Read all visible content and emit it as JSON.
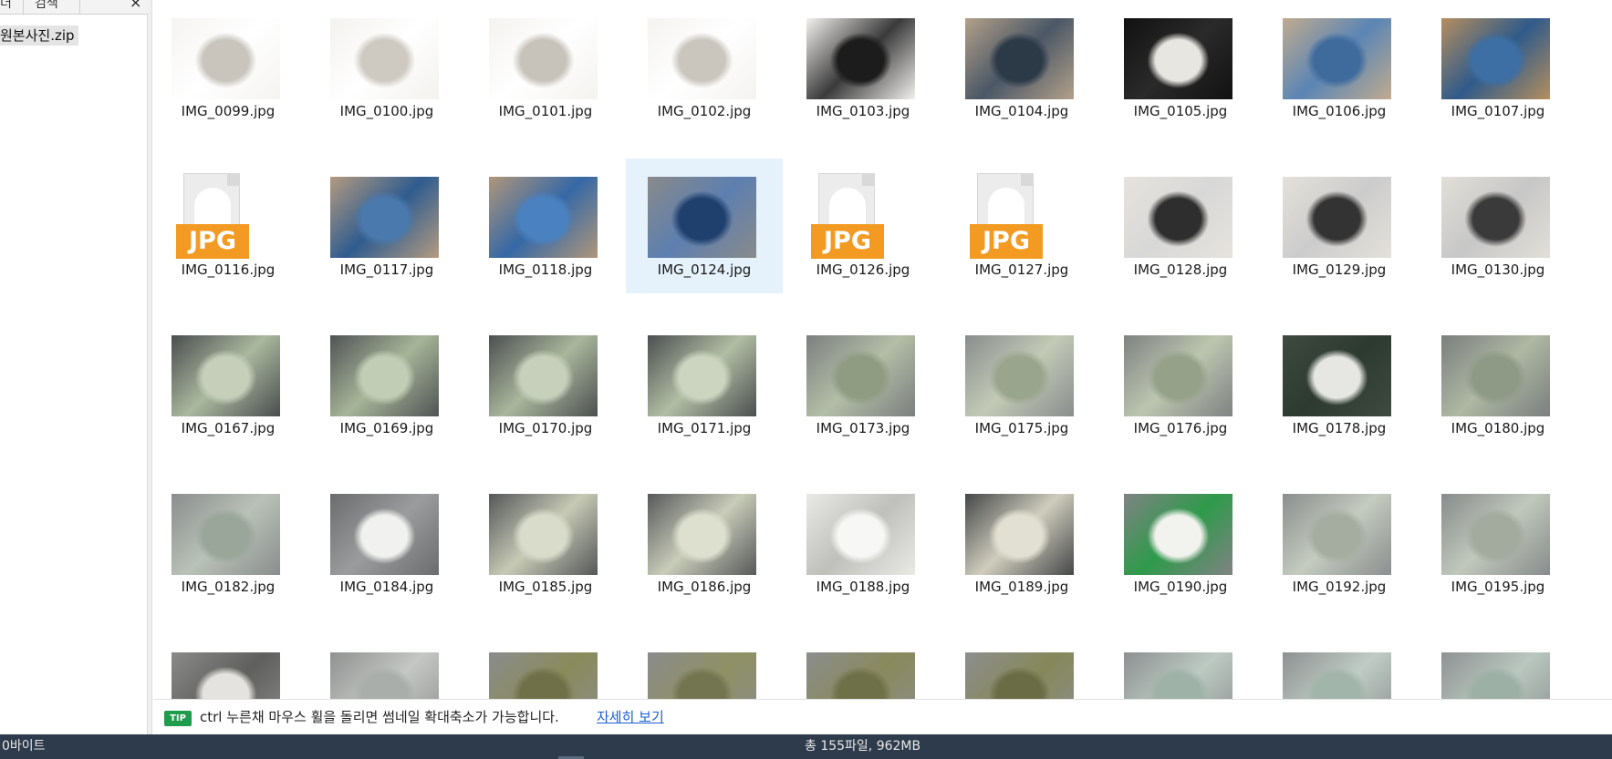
{
  "left_panel": {
    "tabs": [
      "더",
      "검색"
    ],
    "close_label": "×",
    "tree_item": "원본사진.zip"
  },
  "files": [
    {
      "name": "IMG_0099.jpg",
      "kind": "photo",
      "palette": [
        "#f5f4f1",
        "#c9c5bd",
        "#ffffff"
      ]
    },
    {
      "name": "IMG_0100.jpg",
      "kind": "photo",
      "palette": [
        "#f3f2ee",
        "#cfcac1",
        "#ffffff"
      ]
    },
    {
      "name": "IMG_0101.jpg",
      "kind": "photo",
      "palette": [
        "#f4f3ef",
        "#c8c3ba",
        "#ffffff"
      ]
    },
    {
      "name": "IMG_0102.jpg",
      "kind": "photo",
      "palette": [
        "#f4f3f0",
        "#cac5bd",
        "#ffffff"
      ]
    },
    {
      "name": "IMG_0103.jpg",
      "kind": "photo",
      "palette": [
        "#f2f1ee",
        "#1c1c1c",
        "#3a3a3a"
      ]
    },
    {
      "name": "IMG_0104.jpg",
      "kind": "photo",
      "palette": [
        "#b3a089",
        "#2c3a48",
        "#4a5766"
      ]
    },
    {
      "name": "IMG_0105.jpg",
      "kind": "photo",
      "palette": [
        "#111111",
        "#e8e6e0",
        "#2a2a2a"
      ]
    },
    {
      "name": "IMG_0106.jpg",
      "kind": "photo",
      "palette": [
        "#c1ab8e",
        "#3e6a9c",
        "#5a85b5"
      ]
    },
    {
      "name": "IMG_0107.jpg",
      "kind": "photo",
      "palette": [
        "#b58e5e",
        "#3d6fa5",
        "#2f5a8a"
      ]
    },
    {
      "name": "IMG_0116.jpg",
      "kind": "jpg"
    },
    {
      "name": "IMG_0117.jpg",
      "kind": "photo",
      "palette": [
        "#b49a80",
        "#4a79ad",
        "#2f5c8f"
      ]
    },
    {
      "name": "IMG_0118.jpg",
      "kind": "photo",
      "palette": [
        "#b0967a",
        "#4a82c1",
        "#3568a6"
      ]
    },
    {
      "name": "IMG_0124.jpg",
      "kind": "photo",
      "palette": [
        "#8a8a8a",
        "#1f3f6d",
        "#5c7fb0"
      ],
      "selected": true
    },
    {
      "name": "IMG_0126.jpg",
      "kind": "jpg"
    },
    {
      "name": "IMG_0127.jpg",
      "kind": "jpg"
    },
    {
      "name": "IMG_0128.jpg",
      "kind": "photo",
      "palette": [
        "#e6e3dd",
        "#2e2e2e",
        "#d8d8d8"
      ]
    },
    {
      "name": "IMG_0129.jpg",
      "kind": "photo",
      "palette": [
        "#e4e1da",
        "#333333",
        "#cccccc"
      ]
    },
    {
      "name": "IMG_0130.jpg",
      "kind": "photo",
      "palette": [
        "#e2dfd8",
        "#3a3a3a",
        "#c7c7c7"
      ]
    },
    {
      "name": "IMG_0167.jpg",
      "kind": "photo",
      "palette": [
        "#4a4d4f",
        "#c5cfba",
        "#aab89e"
      ]
    },
    {
      "name": "IMG_0169.jpg",
      "kind": "photo",
      "palette": [
        "#505355",
        "#c2cdb6",
        "#a6b598"
      ]
    },
    {
      "name": "IMG_0170.jpg",
      "kind": "photo",
      "palette": [
        "#4c4f51",
        "#c6d0bb",
        "#a9b79c"
      ]
    },
    {
      "name": "IMG_0171.jpg",
      "kind": "photo",
      "palette": [
        "#4b4e50",
        "#ccd5c0",
        "#b1bea4"
      ]
    },
    {
      "name": "IMG_0173.jpg",
      "kind": "photo",
      "palette": [
        "#7c7f80",
        "#8f9c82",
        "#b3bea7"
      ]
    },
    {
      "name": "IMG_0175.jpg",
      "kind": "photo",
      "palette": [
        "#8a8d8e",
        "#9aa58d",
        "#c2cab6"
      ]
    },
    {
      "name": "IMG_0176.jpg",
      "kind": "photo",
      "palette": [
        "#7f8283",
        "#95a189",
        "#bcc6af"
      ]
    },
    {
      "name": "IMG_0178.jpg",
      "kind": "photo",
      "palette": [
        "#3e4a40",
        "#e6e6e2",
        "#2d3a30"
      ]
    },
    {
      "name": "IMG_0180.jpg",
      "kind": "photo",
      "palette": [
        "#7b7e7f",
        "#8e9a86",
        "#aeb8a3"
      ]
    },
    {
      "name": "IMG_0182.jpg",
      "kind": "photo",
      "palette": [
        "#8a8d8e",
        "#9aa69a",
        "#b9c2b7"
      ]
    },
    {
      "name": "IMG_0184.jpg",
      "kind": "photo",
      "palette": [
        "#6a6c6d",
        "#f1f1ef",
        "#9a9c9d"
      ]
    },
    {
      "name": "IMG_0185.jpg",
      "kind": "photo",
      "palette": [
        "#555759",
        "#d9dccb",
        "#c6cab5"
      ]
    },
    {
      "name": "IMG_0186.jpg",
      "kind": "photo",
      "palette": [
        "#57595b",
        "#dde0cf",
        "#c8ccb8"
      ]
    },
    {
      "name": "IMG_0188.jpg",
      "kind": "photo",
      "palette": [
        "#e9e9e6",
        "#f7f7f5",
        "#bfbfbb"
      ]
    },
    {
      "name": "IMG_0189.jpg",
      "kind": "photo",
      "palette": [
        "#454749",
        "#e1e0d2",
        "#cfcdbd"
      ]
    },
    {
      "name": "IMG_0190.jpg",
      "kind": "photo",
      "palette": [
        "#808284",
        "#f2f2ee",
        "#2e9a4a"
      ]
    },
    {
      "name": "IMG_0192.jpg",
      "kind": "photo",
      "palette": [
        "#8b8e8f",
        "#a5ada0",
        "#c4cbbf"
      ]
    },
    {
      "name": "IMG_0195.jpg",
      "kind": "photo",
      "palette": [
        "#888b8c",
        "#a2ab9e",
        "#c0c8bc"
      ]
    },
    {
      "name": "",
      "kind": "photo",
      "palette": [
        "#8a8a88",
        "#e4e3df",
        "#5f5f5d"
      ]
    },
    {
      "name": "",
      "kind": "photo",
      "palette": [
        "#8f9290",
        "#a9aeab",
        "#c4c7c3"
      ]
    },
    {
      "name": "",
      "kind": "photo",
      "palette": [
        "#8a8c8d",
        "#6f7048",
        "#8a8b5a"
      ]
    },
    {
      "name": "",
      "kind": "photo",
      "palette": [
        "#8a8c8d",
        "#737550",
        "#8f9063"
      ]
    },
    {
      "name": "",
      "kind": "photo",
      "palette": [
        "#8b8d8e",
        "#6e7048",
        "#898a5b"
      ]
    },
    {
      "name": "",
      "kind": "photo",
      "palette": [
        "#8c8e8f",
        "#6a6c45",
        "#868859"
      ]
    },
    {
      "name": "",
      "kind": "photo",
      "palette": [
        "#8d9091",
        "#9fb2a8",
        "#bccac2"
      ]
    },
    {
      "name": "",
      "kind": "photo",
      "palette": [
        "#8e9192",
        "#a2b5ab",
        "#bfccc4"
      ]
    },
    {
      "name": "",
      "kind": "photo",
      "palette": [
        "#8f9293",
        "#9db0a6",
        "#b9c7bf"
      ]
    }
  ],
  "tip": {
    "badge": "TIP",
    "text": "ctrl 누른채 마우스 휠을 돌리면 썸네일 확대축소가 가능합니다.",
    "link": "자세히 보기"
  },
  "status": {
    "left": "0바이트",
    "center": "총 155파일,  962MB"
  },
  "colors": {
    "status_bar": "#2e3b4c",
    "selection": "#e5f1fb",
    "jpg_badge": "#f29a21",
    "tip_badge": "#1e9b4b",
    "link": "#1a5fcf"
  }
}
